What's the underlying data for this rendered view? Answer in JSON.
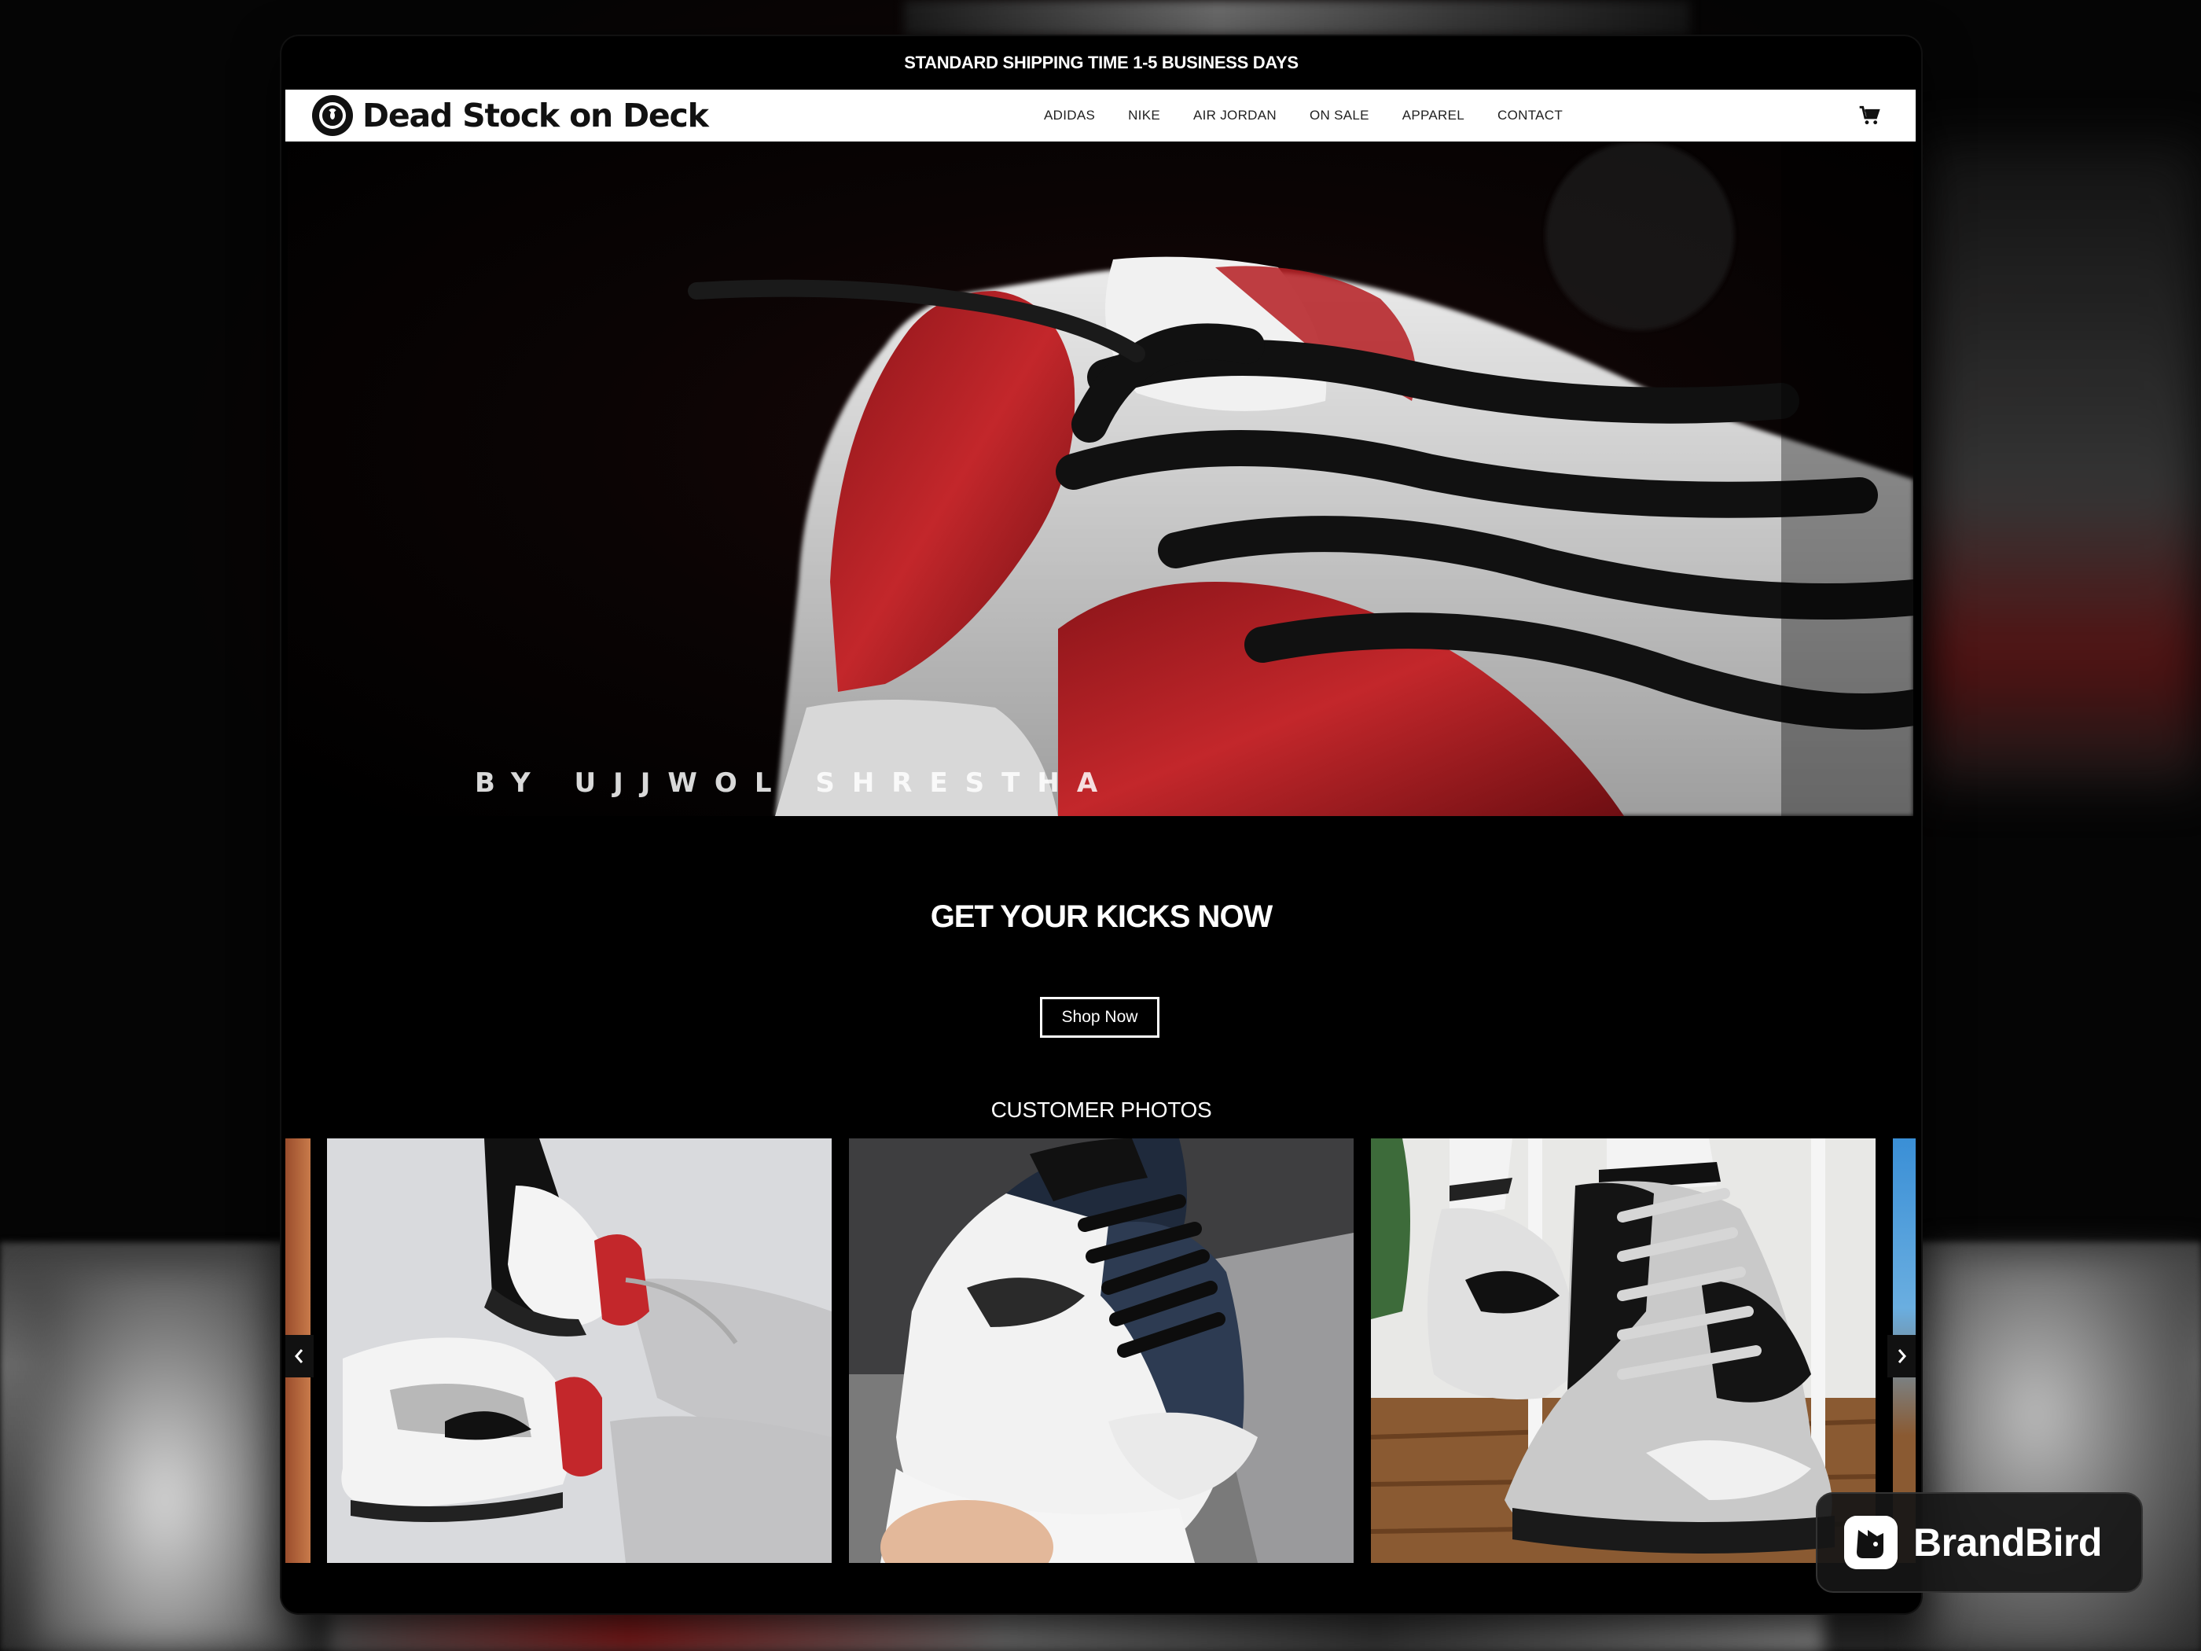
{
  "announcement": "STANDARD SHIPPING TIME 1-5 BUSINESS DAYS",
  "brand": {
    "name": "Dead Stock on Deck"
  },
  "nav": {
    "items": [
      "ADIDAS",
      "NIKE",
      "AIR JORDAN",
      "ON SALE",
      "APPAREL",
      "CONTACT"
    ],
    "cart_icon": "shopping-cart-icon"
  },
  "hero": {
    "credit": "BY UJJWOL SHRESTHA"
  },
  "cta": {
    "headline": "GET YOUR KICKS NOW",
    "button_label": "Shop Now"
  },
  "customer_photos": {
    "title": "CUSTOMER PHOTOS",
    "prev_icon": "chevron-left-icon",
    "next_icon": "chevron-right-icon"
  },
  "watermark": {
    "label": "BrandBird"
  },
  "colors": {
    "accent_red": "#b3161c",
    "background": "#000000",
    "nav_bg": "#ffffff"
  }
}
